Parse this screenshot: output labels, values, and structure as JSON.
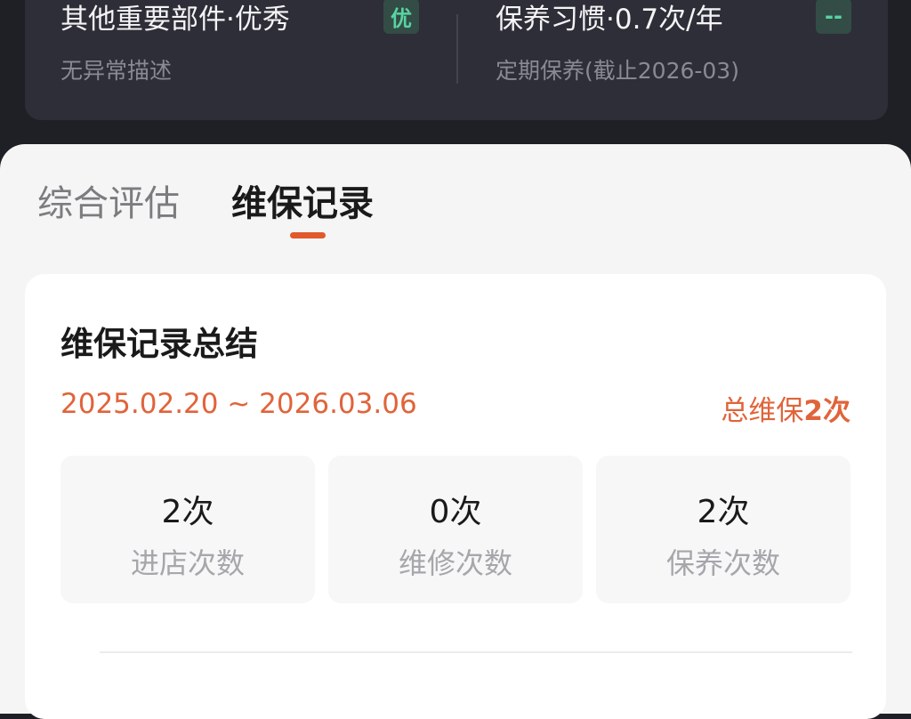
{
  "top_metrics": [
    {
      "title": "其他重要部件·优秀",
      "description": "无异常描述",
      "badge": "优",
      "badge_color": "#58d3a2"
    },
    {
      "title": "保养习惯·0.7次/年",
      "description": "定期保养(截止2026-03)",
      "badge": "--",
      "badge_color": "#58d3a2"
    }
  ],
  "tabs": [
    {
      "label": "综合评估",
      "active": false
    },
    {
      "label": "维保记录",
      "active": true
    }
  ],
  "summary": {
    "title": "维保记录总结",
    "date_range": "2025.02.20 ~ 2026.03.06",
    "total_prefix": "总维保",
    "total_value": "2次"
  },
  "stats": [
    {
      "value": "2次",
      "label": "进店次数"
    },
    {
      "value": "0次",
      "label": "维修次数"
    },
    {
      "value": "2次",
      "label": "保养次数"
    }
  ],
  "colors": {
    "accent": "#e05a2b",
    "dark_bg": "#1f1f26",
    "card_dark": "#2e2e38",
    "good_green": "#58d3a2"
  }
}
